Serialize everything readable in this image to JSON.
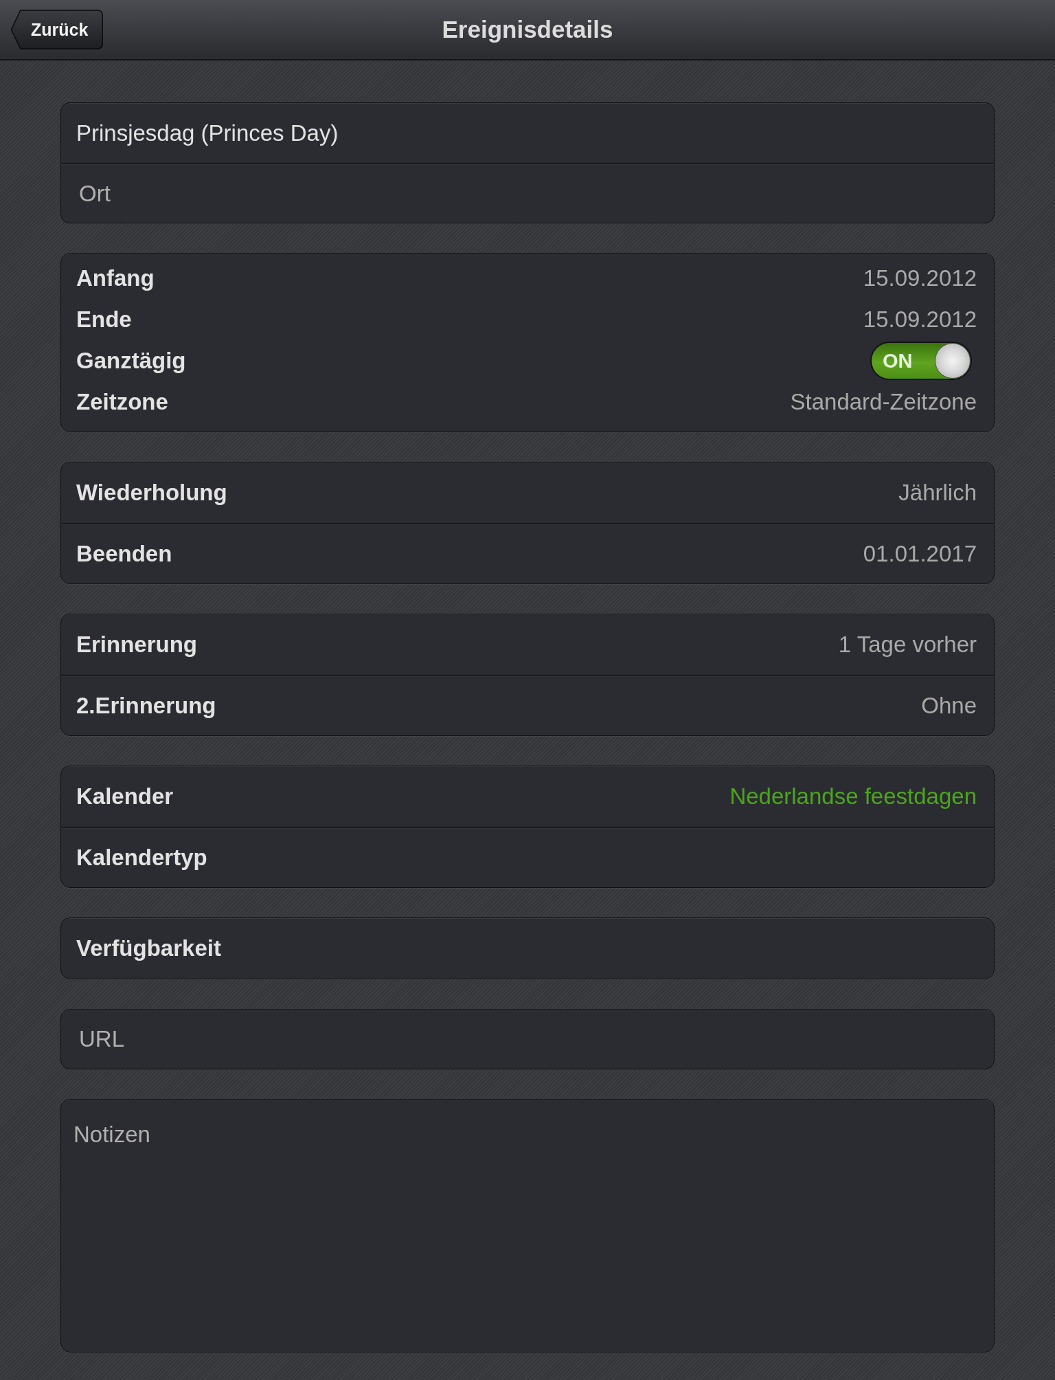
{
  "nav_bar": {
    "back_button": "Zurück",
    "title": "Ereignisdetails"
  },
  "groups": [
    {
      "kind": "list",
      "rows": [
        {
          "kind": "field",
          "value": "Prinsjesdag (Princes Day)"
        },
        {
          "kind": "field",
          "placeholder": "Ort"
        }
      ]
    },
    {
      "kind": "compact",
      "rows": [
        {
          "kind": "detail",
          "label": "Anfang",
          "value": "15.09.2012"
        },
        {
          "kind": "detail",
          "label": "Ende",
          "value": "15.09.2012"
        },
        {
          "kind": "switch",
          "label": "Ganztägig",
          "on": true,
          "switch_text": "ON"
        },
        {
          "kind": "detail",
          "label": "Zeitzone",
          "value": "Standard-Zeitzone"
        }
      ]
    },
    {
      "kind": "list",
      "rows": [
        {
          "kind": "detail",
          "label": "Wiederholung",
          "value": "Jährlich"
        },
        {
          "kind": "detail",
          "label": "Beenden",
          "value": "01.01.2017"
        }
      ]
    },
    {
      "kind": "list",
      "rows": [
        {
          "kind": "detail",
          "label": "Erinnerung",
          "value": "1 Tage vorher"
        },
        {
          "kind": "detail",
          "label": "2.Erinnerung",
          "value": "Ohne"
        }
      ]
    },
    {
      "kind": "list",
      "rows": [
        {
          "kind": "detail",
          "label": "Kalender",
          "value": "Nederlandse feestdagen",
          "color": "#4ba61c"
        },
        {
          "kind": "detail",
          "label": "Kalendertyp"
        }
      ]
    },
    {
      "kind": "list",
      "rows": [
        {
          "kind": "detail",
          "label": "Verfügbarkeit"
        }
      ]
    },
    {
      "kind": "list",
      "rows": [
        {
          "kind": "field",
          "placeholder": "URL"
        }
      ]
    },
    {
      "kind": "list",
      "rows": [
        {
          "kind": "notes",
          "placeholder": "Notizen"
        }
      ]
    }
  ]
}
